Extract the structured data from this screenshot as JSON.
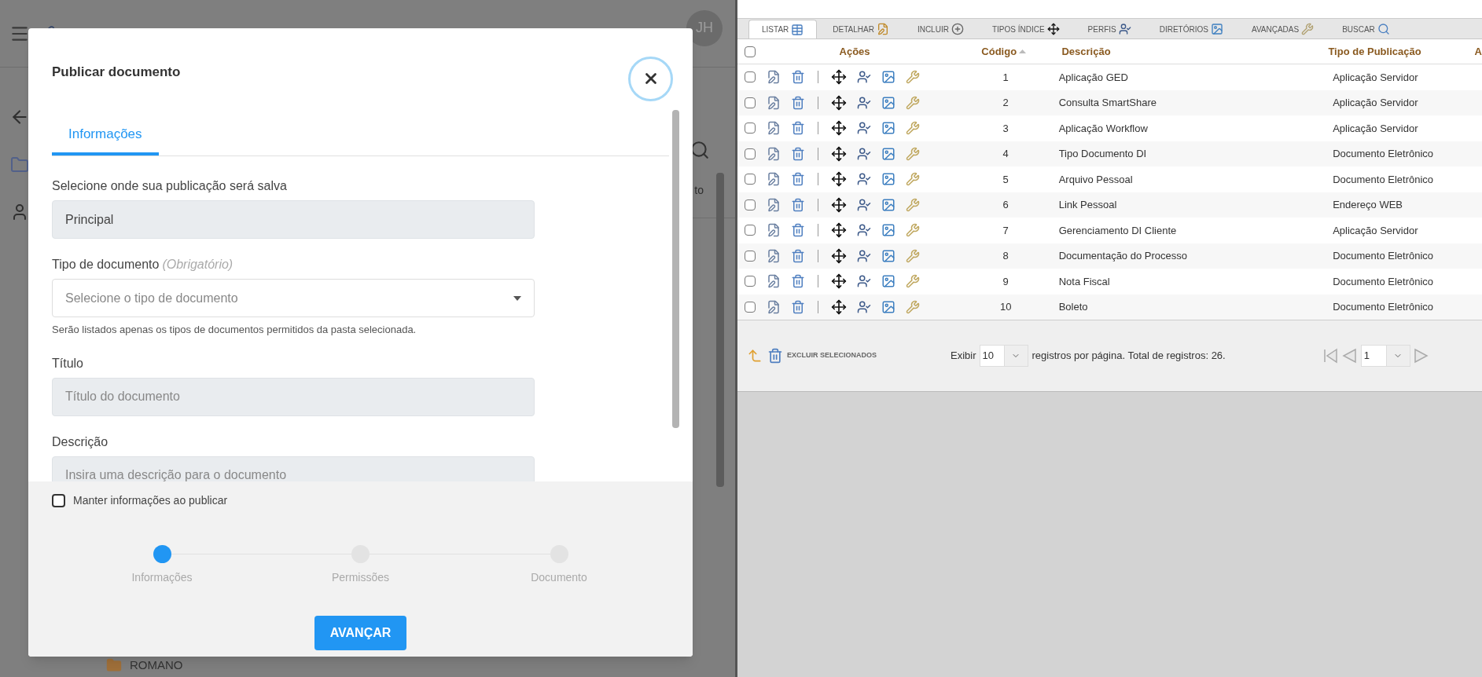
{
  "background_app": {
    "avatar": "JH",
    "column_header": "to",
    "folder_item": "ROMANO"
  },
  "modal": {
    "title": "Publicar documento",
    "tabs": [
      {
        "label": "Informações",
        "selected": true
      }
    ],
    "fields": [
      {
        "kind": "input",
        "label": "Selecione onde sua publicação será salva",
        "value": "Principal"
      },
      {
        "kind": "select",
        "label": "Tipo de documento",
        "label_note": "(Obrigatório)",
        "placeholder": "Selecione o tipo de documento",
        "hint": "Serão listados apenas os tipos de documentos permitidos da pasta selecionada."
      },
      {
        "kind": "input",
        "label": "Título",
        "placeholder": "Título do documento"
      },
      {
        "kind": "input",
        "label": "Descrição",
        "placeholder": "Insira uma descrição para o documento"
      }
    ],
    "keep_info": {
      "label": "Manter informações ao publicar",
      "checked": false
    },
    "steps": [
      {
        "label": "Informações",
        "selected": true
      },
      {
        "label": "Permissões",
        "selected": false
      },
      {
        "label": "Documento",
        "selected": false
      }
    ],
    "primary_button": "AVANÇAR"
  },
  "admin": {
    "tabs": [
      {
        "label": "LISTAR",
        "selected": true
      },
      {
        "label": "DETALHAR",
        "selected": false
      },
      {
        "label": "INCLUIR",
        "selected": false
      },
      {
        "label": "TIPOS ÍNDICE",
        "selected": false
      },
      {
        "label": "PERFIS",
        "selected": false
      },
      {
        "label": "DIRETÓRIOS",
        "selected": false
      },
      {
        "label": "AVANÇADAS",
        "selected": false
      },
      {
        "label": "BUSCAR",
        "selected": false
      }
    ],
    "select_all_checked": false,
    "columns": [
      {
        "label": "Ações",
        "sorted": false
      },
      {
        "label": "Código",
        "sorted": true
      },
      {
        "label": "Descrição",
        "sorted": false
      },
      {
        "label": "Tipo de Publicação",
        "sorted": false
      },
      {
        "label": "A",
        "sorted": false
      }
    ],
    "rows": [
      {
        "checked": false,
        "code": "1",
        "description": "Aplicação GED",
        "type": "Aplicação Servidor"
      },
      {
        "checked": false,
        "code": "2",
        "description": "Consulta SmartShare",
        "type": "Aplicação Servidor"
      },
      {
        "checked": false,
        "code": "3",
        "description": "Aplicação Workflow",
        "type": "Aplicação Servidor"
      },
      {
        "checked": false,
        "code": "4",
        "description": "Tipo Documento DI",
        "type": "Documento Eletrônico"
      },
      {
        "checked": false,
        "code": "5",
        "description": "Arquivo Pessoal",
        "type": "Documento Eletrônico"
      },
      {
        "checked": false,
        "code": "6",
        "description": "Link Pessoal",
        "type": "Endereço WEB"
      },
      {
        "checked": false,
        "code": "7",
        "description": "Gerenciamento DI Cliente",
        "type": "Aplicação Servidor"
      },
      {
        "checked": false,
        "code": "8",
        "description": "Documentação do Processo",
        "type": "Documento Eletrônico"
      },
      {
        "checked": false,
        "code": "9",
        "description": "Nota Fiscal",
        "type": "Documento Eletrônico"
      },
      {
        "checked": false,
        "code": "10",
        "description": "Boleto",
        "type": "Documento Eletrônico"
      }
    ],
    "bulk_delete": "EXCLUIR SELECIONADOS",
    "page_size_label": "Exibir",
    "page_size": "10",
    "summary": "registros por página. Total de registros: 26.",
    "page": "1"
  }
}
